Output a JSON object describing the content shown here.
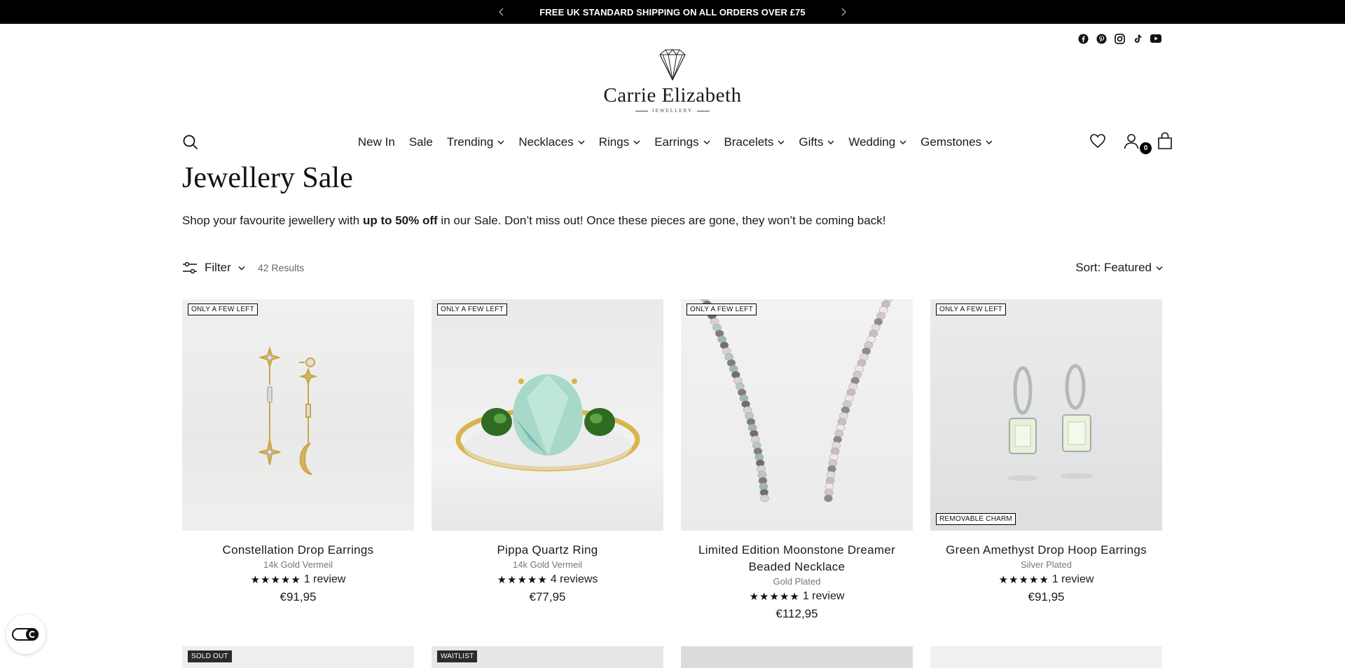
{
  "announcement": {
    "text": "FREE UK STANDARD SHIPPING ON ALL ORDERS OVER £75"
  },
  "social": [
    "facebook-icon",
    "pinterest-icon",
    "instagram-icon",
    "tiktok-icon",
    "youtube-icon"
  ],
  "logo": {
    "wordmark": "Carrie Elizabeth",
    "sub": "JEWELLERY"
  },
  "nav": {
    "items": [
      {
        "label": "New In",
        "dropdown": false
      },
      {
        "label": "Sale",
        "dropdown": false
      },
      {
        "label": "Trending",
        "dropdown": true
      },
      {
        "label": "Necklaces",
        "dropdown": true
      },
      {
        "label": "Rings",
        "dropdown": true
      },
      {
        "label": "Earrings",
        "dropdown": true
      },
      {
        "label": "Bracelets",
        "dropdown": true
      },
      {
        "label": "Gifts",
        "dropdown": true
      },
      {
        "label": "Wedding",
        "dropdown": true
      },
      {
        "label": "Gemstones",
        "dropdown": true
      }
    ]
  },
  "cart": {
    "count": "0"
  },
  "page": {
    "title": "Jewellery Sale",
    "intro_before": "Shop your favourite jewellery with ",
    "intro_bold": "up to 50% off",
    "intro_after": " in our Sale. Don’t miss out! Once these pieces are gone, they won’t be coming back!"
  },
  "toolbar": {
    "filter_label": "Filter",
    "results": "42 Results",
    "sort_label": "Sort: Featured"
  },
  "products": [
    {
      "name": "Constellation Drop Earrings",
      "variant": "14k Gold Vermeil",
      "stars": "★★★★★",
      "reviews": "1 review",
      "price": "€91,95",
      "badge": "ONLY A FEW LEFT",
      "badge_bottom": ""
    },
    {
      "name": "Pippa Quartz Ring",
      "variant": "14k Gold Vermeil",
      "stars": "★★★★★",
      "reviews": "4 reviews",
      "price": "€77,95",
      "badge": "ONLY A FEW LEFT",
      "badge_bottom": ""
    },
    {
      "name": "Limited Edition Moonstone Dreamer Beaded Necklace",
      "variant": "Gold Plated",
      "stars": "★★★★★",
      "reviews": "1 review",
      "price": "€112,95",
      "badge": "ONLY A FEW LEFT",
      "badge_bottom": ""
    },
    {
      "name": "Green Amethyst Drop Hoop Earrings",
      "variant": "Silver Plated",
      "stars": "★★★★★",
      "reviews": "1 review",
      "price": "€91,95",
      "badge": "ONLY A FEW LEFT",
      "badge_bottom": "REMOVABLE CHARM"
    }
  ],
  "row2_badges": [
    "SOLD OUT",
    "WAITLIST",
    "",
    ""
  ]
}
